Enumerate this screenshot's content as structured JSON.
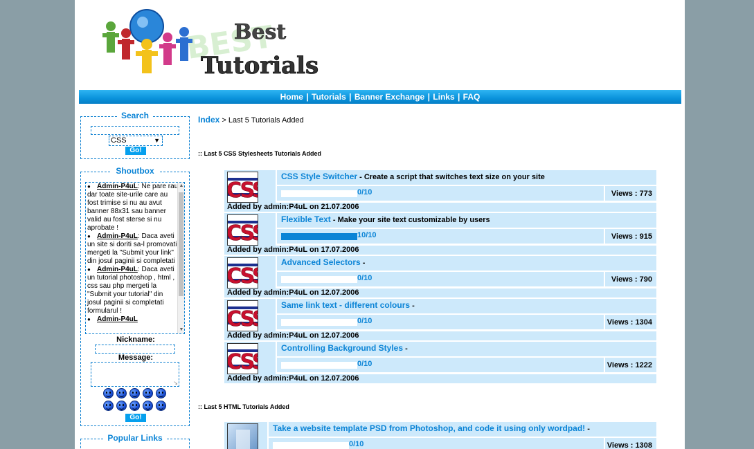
{
  "site": {
    "logo_text_line1": "Best",
    "logo_text_line2": "Tutorials"
  },
  "nav": {
    "items": [
      "Home",
      "Tutorials",
      "Banner Exchange",
      "Links",
      "FAQ"
    ],
    "separator": "|"
  },
  "search": {
    "title": "Search",
    "query": "",
    "category_selected": "CSS",
    "go_label": "Go!"
  },
  "shoutbox": {
    "title": "Shoutbox",
    "messages": [
      {
        "author": "Admin-P4uL",
        "text": ": Ne pare rau dar toate site-urile care au fost trimise si nu au avut banner 88x31 sau banner valid au fost sterse si nu aprobate !"
      },
      {
        "author": "Admin-P4uL",
        "text": ": Daca aveti un site si doriti sa-l promovati mergeti la \"Submit your link\" din josul paginii si completati"
      },
      {
        "author": "Admin-P4uL",
        "text": ": Daca aveti un tutorial photoshop , html , css sau php mergeti la \"Submit your tutorial\" din josul paginii si completati formularul !"
      },
      {
        "author": "Admin-P4uL",
        "text": ""
      }
    ],
    "nickname_label": "Nickname:",
    "message_label": "Message:",
    "go_label": "Go!"
  },
  "popular_links": {
    "title": "Popular Links"
  },
  "breadcrumb": {
    "root": "Index",
    "separator": ">",
    "current": "Last 5 Tutorials Added"
  },
  "sections": {
    "css_heading": ":: Last 5 CSS Stylesheets Tutorials Added",
    "html_heading": ":: Last 5 HTML Tutorials Added"
  },
  "css_tutorials": [
    {
      "title": "CSS Style Switcher",
      "desc": " - Create a script that switches text size on your site",
      "rating": "0/10",
      "rating_fraction": 0,
      "views": "Views : 773",
      "added": "Added by admin:P4uL on 21.07.2006"
    },
    {
      "title": "Flexible Text",
      "desc": " - Make your site text customizable by users",
      "rating": "10/10",
      "rating_fraction": 1,
      "views": "Views : 915",
      "added": "Added by admin:P4uL on 17.07.2006"
    },
    {
      "title": "Advanced Selectors",
      "desc": " -",
      "rating": "0/10",
      "rating_fraction": 0,
      "views": "Views : 790",
      "added": "Added by admin:P4uL on 12.07.2006"
    },
    {
      "title": "Same link text - different colours",
      "desc": " -",
      "rating": "0/10",
      "rating_fraction": 0,
      "views": "Views : 1304",
      "added": "Added by admin:P4uL on 12.07.2006"
    },
    {
      "title": "Controlling Background Styles",
      "desc": " -",
      "rating": "0/10",
      "rating_fraction": 0,
      "views": "Views : 1222",
      "added": "Added by admin:P4uL on 12.07.2006"
    }
  ],
  "html_tutorials": [
    {
      "title": "Take a website template PSD from Photoshop, and code it using only wordpad!",
      "desc": " -",
      "rating": "0/10",
      "rating_fraction": 0,
      "views": "Views : 1308"
    }
  ],
  "colors": {
    "accent": "#0b84d6",
    "row_bg": "#cde9fb",
    "background": "#8a9ea6"
  }
}
